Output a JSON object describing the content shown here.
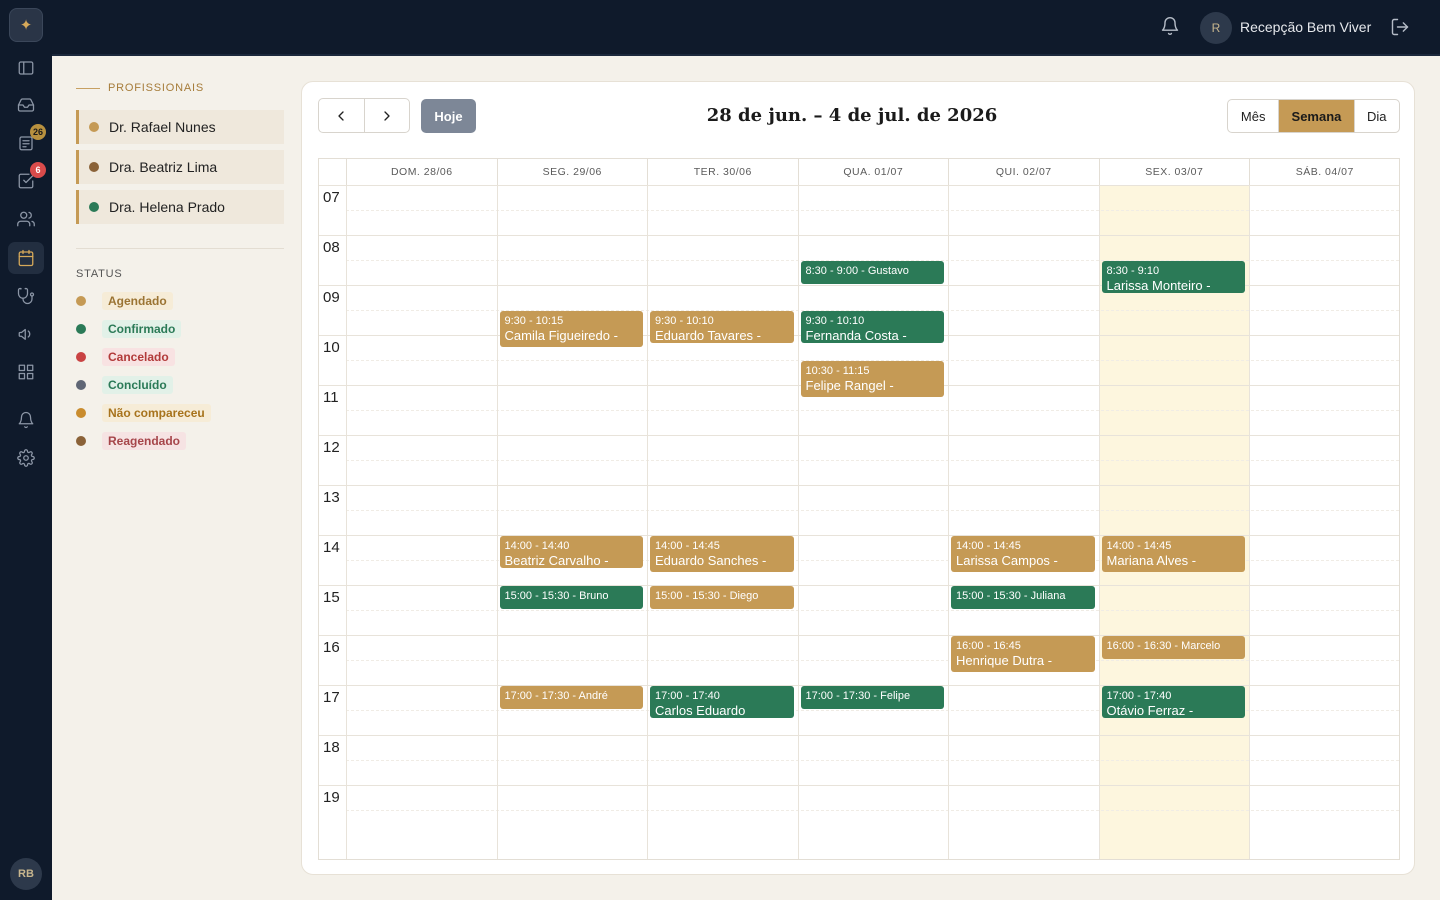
{
  "app": {
    "logo_glyph": "✦",
    "user_initials": "RB"
  },
  "sidebar": {
    "items": [
      {
        "icon": "panel-icon"
      },
      {
        "icon": "inbox-icon"
      },
      {
        "icon": "clipboard-icon",
        "badge": "26"
      },
      {
        "icon": "checkbox-icon",
        "badge": "6"
      },
      {
        "icon": "users-icon"
      },
      {
        "icon": "calendar-icon",
        "active": true
      },
      {
        "icon": "stethoscope-icon"
      },
      {
        "icon": "megaphone-icon"
      },
      {
        "icon": "grid-icon"
      },
      {
        "icon": "bell-icon"
      },
      {
        "icon": "settings-icon"
      }
    ]
  },
  "topbar": {
    "avatar_initial": "R",
    "user_name": "Recepção Bem Viver"
  },
  "filters": {
    "professionals_title": "PROFISSIONAIS",
    "professionals": [
      {
        "name": "Dr. Rafael Nunes",
        "color": "#c59a55"
      },
      {
        "name": "Dra. Beatriz Lima",
        "color": "#8a6238"
      },
      {
        "name": "Dra. Helena Prado",
        "color": "#2b7a57"
      }
    ],
    "status_title": "STATUS",
    "statuses": [
      {
        "label": "Agendado",
        "dot": "#c59a55",
        "bg": "#f6ecd7",
        "fg": "#9b7433"
      },
      {
        "label": "Confirmado",
        "dot": "#2b7a57",
        "bg": "#e2f1e8",
        "fg": "#2b7a57"
      },
      {
        "label": "Cancelado",
        "dot": "#c94343",
        "bg": "#f8e2e2",
        "fg": "#b23a3a"
      },
      {
        "label": "Concluído",
        "dot": "#5f6675",
        "bg": "#e2f1e8",
        "fg": "#2b7a57"
      },
      {
        "label": "Não compareceu",
        "dot": "#c98c2e",
        "bg": "#f6ecd7",
        "fg": "#a7731c"
      },
      {
        "label": "Reagendado",
        "dot": "#8a6238",
        "bg": "#f6e3e3",
        "fg": "#a6454a"
      }
    ]
  },
  "calendar": {
    "today_label": "Hoje",
    "range_title": "28 de jun. – 4 de jul. de 2026",
    "views": [
      {
        "label": "Mês"
      },
      {
        "label": "Semana",
        "active": true
      },
      {
        "label": "Dia"
      }
    ],
    "days": [
      "DOM. 28/06",
      "SEG. 29/06",
      "TER. 30/06",
      "QUA. 01/07",
      "QUI. 02/07",
      "SEX. 03/07",
      "SÁB. 04/07"
    ],
    "today_index": 5,
    "hours": [
      "07",
      "08",
      "09",
      "10",
      "11",
      "12",
      "13",
      "14",
      "15",
      "16",
      "17",
      "18",
      "19"
    ],
    "events": [
      {
        "day": 1,
        "start": 9.5,
        "end": 10.25,
        "color": "gold",
        "time": "9:30 - 10:15",
        "title": "Camila Figueiredo -"
      },
      {
        "day": 1,
        "start": 14,
        "end": 14.67,
        "color": "gold",
        "time": "14:00 - 14:40",
        "title": "Beatriz Carvalho -"
      },
      {
        "day": 1,
        "start": 15,
        "end": 15.5,
        "color": "green",
        "time": "15:00 - 15:30 - Bruno",
        "title": ""
      },
      {
        "day": 1,
        "start": 17,
        "end": 17.5,
        "color": "gold",
        "time": "17:00 - 17:30 - André",
        "title": ""
      },
      {
        "day": 2,
        "start": 9.5,
        "end": 10.17,
        "color": "gold",
        "time": "9:30 - 10:10",
        "title": "Eduardo Tavares -"
      },
      {
        "day": 2,
        "start": 14,
        "end": 14.75,
        "color": "gold",
        "time": "14:00 - 14:45",
        "title": "Eduardo Sanches -"
      },
      {
        "day": 2,
        "start": 15,
        "end": 15.5,
        "color": "gold",
        "time": "15:00 - 15:30 - Diego",
        "title": ""
      },
      {
        "day": 2,
        "start": 17,
        "end": 17.67,
        "color": "green",
        "time": "17:00 - 17:40",
        "title": "Carlos Eduardo"
      },
      {
        "day": 3,
        "start": 8.5,
        "end": 9,
        "color": "green",
        "time": "8:30 - 9:00 - Gustavo",
        "title": ""
      },
      {
        "day": 3,
        "start": 9.5,
        "end": 10.17,
        "color": "green",
        "time": "9:30 - 10:10",
        "title": "Fernanda Costa -"
      },
      {
        "day": 3,
        "start": 10.5,
        "end": 11.25,
        "color": "gold",
        "time": "10:30 - 11:15",
        "title": "Felipe Rangel -"
      },
      {
        "day": 3,
        "start": 17,
        "end": 17.5,
        "color": "green",
        "time": "17:00 - 17:30 - Felipe",
        "title": ""
      },
      {
        "day": 4,
        "start": 14,
        "end": 14.75,
        "color": "gold",
        "time": "14:00 - 14:45",
        "title": "Larissa Campos -"
      },
      {
        "day": 4,
        "start": 15,
        "end": 15.5,
        "color": "green",
        "time": "15:00 - 15:30 - Juliana",
        "title": ""
      },
      {
        "day": 4,
        "start": 16,
        "end": 16.75,
        "color": "gold",
        "time": "16:00 - 16:45",
        "title": "Henrique Dutra -"
      },
      {
        "day": 5,
        "start": 8.5,
        "end": 9.17,
        "color": "green",
        "time": "8:30 - 9:10",
        "title": "Larissa Monteiro -"
      },
      {
        "day": 5,
        "start": 14,
        "end": 14.75,
        "color": "gold",
        "time": "14:00 - 14:45",
        "title": "Mariana Alves -"
      },
      {
        "day": 5,
        "start": 16,
        "end": 16.5,
        "color": "gold",
        "time": "16:00 - 16:30 - Marcelo",
        "title": ""
      },
      {
        "day": 5,
        "start": 17,
        "end": 17.67,
        "color": "green",
        "time": "17:00 - 17:40",
        "title": "Otávio Ferraz -"
      }
    ]
  }
}
